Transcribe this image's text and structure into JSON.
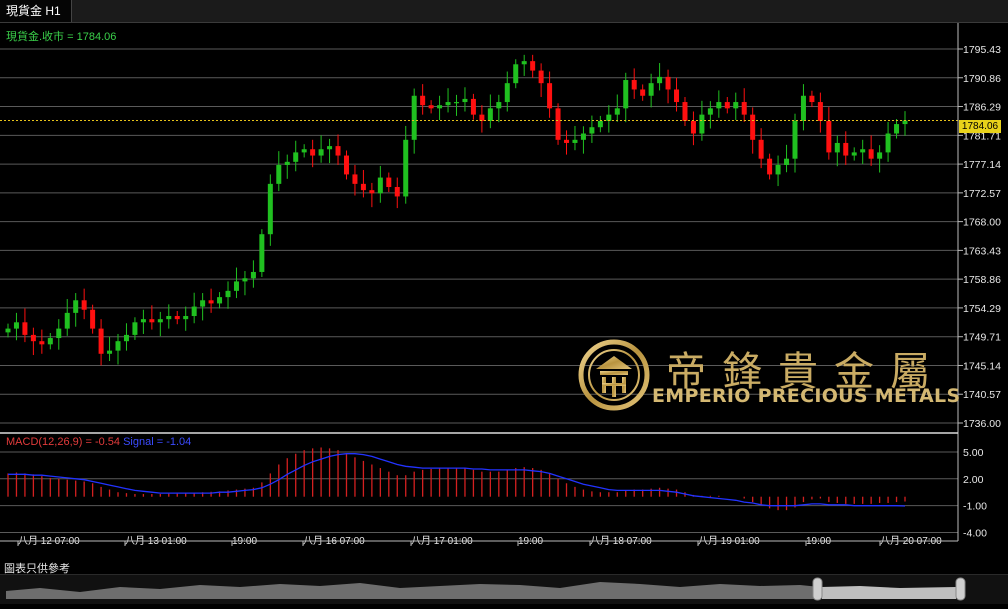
{
  "window": {
    "tab_title": "現貨金 H1"
  },
  "price_panel": {
    "legend": "現貨金.收市 = 1784.06",
    "current_price": "1784.06",
    "y_ticks": [
      "1795.43",
      "1790.86",
      "1786.29",
      "1781.71",
      "1777.14",
      "1772.57",
      "1768.00",
      "1763.43",
      "1758.86",
      "1754.29",
      "1749.71",
      "1745.14",
      "1740.57",
      "1736.00"
    ]
  },
  "macd_panel": {
    "legend_macd": "MACD(12,26,9) = -0.54",
    "legend_signal": "Signal = -1.04",
    "y_ticks": [
      "5.00",
      "2.00",
      "-1.00",
      "-4.00"
    ]
  },
  "x_axis": {
    "labels": [
      "八月 12 07:00",
      "八月 13 01:00",
      "19:00",
      "八月 16 07:00",
      "八月 17 01:00",
      "19:00",
      "八月 18 07:00",
      "八月 19 01:00",
      "19:00",
      "八月 20 07:00"
    ]
  },
  "footer": {
    "disclaimer": "圖表只供參考"
  },
  "logo": {
    "chinese": "帝鋒貴金屬",
    "english": "EMPERIO PRECIOUS METALS"
  },
  "colors": {
    "up": "#20c020",
    "down": "#ff1010",
    "macd_bar": "#d42020",
    "signal": "#2233ff",
    "grid": "#5a5a5a",
    "price_line": "#e8c41a"
  },
  "chart_data": [
    {
      "type": "candlestick",
      "title": "現貨金.收市 = 1784.06",
      "interval": "H1",
      "ylim": [
        1736.0,
        1795.43
      ],
      "x_tick_labels": [
        "八月 12 07:00",
        "八月 13 01:00",
        "19:00",
        "八月 16 07:00",
        "八月 17 01:00",
        "19:00",
        "八月 18 07:00",
        "八月 19 01:00",
        "19:00",
        "八月 20 07:00"
      ],
      "close": [
        1751,
        1752,
        1750,
        1749,
        1748.5,
        1749.5,
        1751,
        1753.5,
        1755.5,
        1754,
        1751,
        1747,
        1747.5,
        1749,
        1750,
        1752,
        1752.5,
        1752,
        1752.5,
        1753,
        1752.5,
        1753,
        1754.5,
        1755.5,
        1755,
        1756,
        1757,
        1758.5,
        1759,
        1760,
        1766,
        1774,
        1777,
        1777.5,
        1779,
        1779.5,
        1778.5,
        1779.5,
        1780,
        1778.5,
        1775.5,
        1774,
        1773,
        1772.5,
        1775,
        1773.5,
        1772,
        1781,
        1788,
        1786.5,
        1786,
        1786.5,
        1787,
        1787,
        1787.5,
        1785,
        1784,
        1786,
        1787,
        1790,
        1793,
        1793.5,
        1792,
        1790,
        1786,
        1781,
        1780.5,
        1781,
        1782,
        1783,
        1784,
        1785,
        1786,
        1790.5,
        1789,
        1788,
        1790,
        1791,
        1789,
        1787,
        1784,
        1782,
        1785,
        1786,
        1787,
        1786,
        1787,
        1785,
        1781,
        1778,
        1775.5,
        1777,
        1778,
        1784,
        1788,
        1787,
        1784,
        1779,
        1780.5,
        1778.5,
        1779,
        1779.5,
        1778,
        1779,
        1782,
        1783.5,
        1784.06
      ],
      "hl_range": {
        "low": 1740.5,
        "high": 1794.5
      }
    },
    {
      "type": "bar",
      "title": "MACD(12,26,9) = -0.54 Signal = -1.04",
      "ylim": [
        -4.5,
        6
      ],
      "series": [
        {
          "name": "MACD(12,26,9)",
          "values": [
            2.6,
            2.7,
            2.6,
            2.5,
            2.3,
            2.1,
            2.0,
            1.9,
            1.8,
            1.7,
            1.5,
            1.1,
            0.8,
            0.5,
            0.4,
            0.3,
            0.3,
            0.3,
            0.3,
            0.35,
            0.35,
            0.4,
            0.45,
            0.5,
            0.55,
            0.6,
            0.7,
            0.8,
            0.9,
            1.0,
            1.6,
            2.6,
            3.6,
            4.3,
            4.8,
            5.2,
            5.4,
            5.5,
            5.4,
            5.2,
            4.8,
            4.4,
            4.0,
            3.6,
            3.2,
            2.8,
            2.4,
            2.4,
            2.8,
            3.0,
            3.1,
            3.2,
            3.2,
            3.2,
            3.2,
            3.0,
            2.8,
            2.8,
            2.8,
            3.0,
            3.2,
            3.3,
            3.2,
            3.0,
            2.6,
            2.0,
            1.5,
            1.1,
            0.8,
            0.6,
            0.5,
            0.5,
            0.5,
            0.7,
            0.8,
            0.8,
            0.9,
            1.0,
            0.9,
            0.8,
            0.5,
            0.2,
            0.1,
            0.1,
            0.1,
            0.0,
            0.0,
            -0.2,
            -0.6,
            -1.0,
            -1.3,
            -1.5,
            -1.5,
            -1.2,
            -0.6,
            -0.3,
            -0.2,
            -0.6,
            -0.7,
            -0.8,
            -0.8,
            -0.8,
            -0.8,
            -0.7,
            -0.7,
            -0.6,
            -0.54
          ]
        },
        {
          "name": "Signal",
          "values": [
            2.5,
            2.5,
            2.5,
            2.4,
            2.4,
            2.3,
            2.2,
            2.1,
            2.0,
            1.9,
            1.7,
            1.5,
            1.3,
            1.1,
            0.9,
            0.7,
            0.6,
            0.5,
            0.4,
            0.4,
            0.4,
            0.4,
            0.4,
            0.4,
            0.4,
            0.5,
            0.5,
            0.6,
            0.7,
            0.8,
            1.0,
            1.4,
            1.9,
            2.5,
            3.0,
            3.5,
            3.9,
            4.2,
            4.5,
            4.7,
            4.8,
            4.8,
            4.7,
            4.5,
            4.2,
            3.9,
            3.6,
            3.4,
            3.3,
            3.2,
            3.2,
            3.2,
            3.2,
            3.2,
            3.2,
            3.1,
            3.1,
            3.0,
            3.0,
            3.0,
            3.0,
            3.0,
            2.9,
            2.8,
            2.6,
            2.3,
            2.0,
            1.7,
            1.4,
            1.2,
            1.0,
            0.8,
            0.7,
            0.7,
            0.7,
            0.7,
            0.7,
            0.7,
            0.6,
            0.5,
            0.3,
            0.1,
            0.0,
            -0.1,
            -0.2,
            -0.3,
            -0.4,
            -0.6,
            -0.7,
            -0.9,
            -1.0,
            -1.0,
            -1.0,
            -1.0,
            -0.9,
            -0.8,
            -0.8,
            -0.9,
            -0.9,
            -0.9,
            -1.0,
            -1.0,
            -1.0,
            -1.0,
            -1.0,
            -1.0,
            -1.04
          ]
        }
      ]
    }
  ]
}
